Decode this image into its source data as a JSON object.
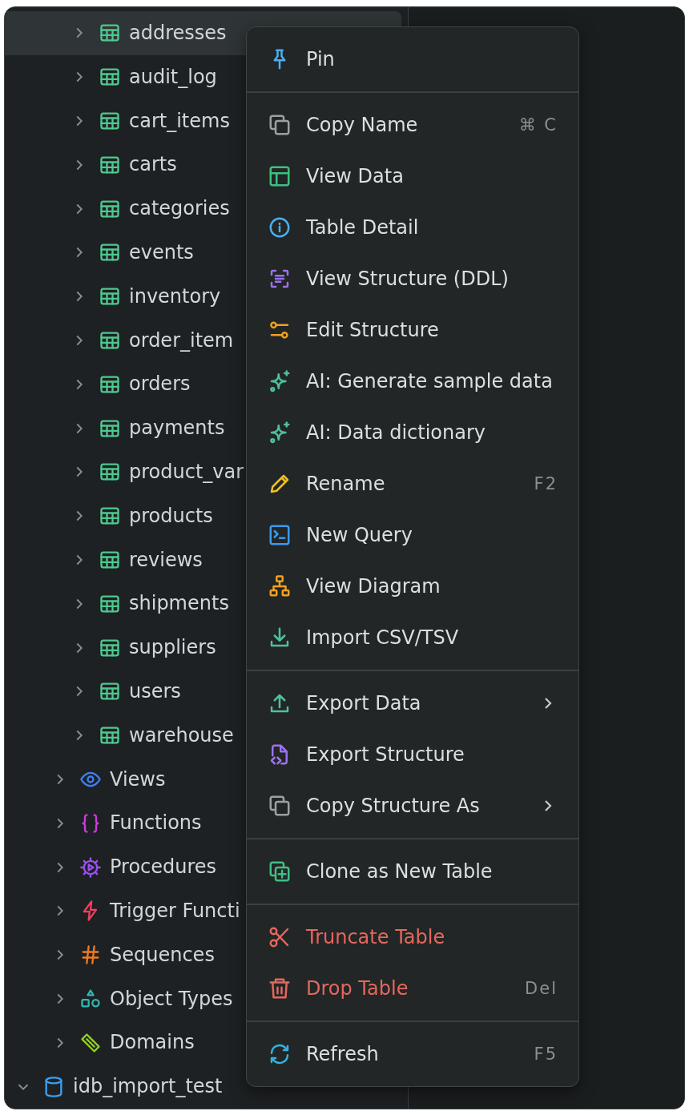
{
  "tree": {
    "tables": [
      {
        "label": "addresses",
        "selected": true,
        "expanded": false
      },
      {
        "label": "audit_log",
        "selected": false,
        "expanded": false
      },
      {
        "label": "cart_items",
        "selected": false,
        "expanded": false
      },
      {
        "label": "carts",
        "selected": false,
        "expanded": false
      },
      {
        "label": "categories",
        "selected": false,
        "expanded": false
      },
      {
        "label": "events",
        "selected": false,
        "expanded": false
      },
      {
        "label": "inventory",
        "selected": false,
        "expanded": false
      },
      {
        "label": "order_item",
        "selected": false,
        "expanded": false
      },
      {
        "label": "orders",
        "selected": false,
        "expanded": false
      },
      {
        "label": "payments",
        "selected": false,
        "expanded": false
      },
      {
        "label": "product_var",
        "selected": false,
        "expanded": false
      },
      {
        "label": "products",
        "selected": false,
        "expanded": false
      },
      {
        "label": "reviews",
        "selected": false,
        "expanded": false
      },
      {
        "label": "shipments",
        "selected": false,
        "expanded": false
      },
      {
        "label": "suppliers",
        "selected": false,
        "expanded": false
      },
      {
        "label": "users",
        "selected": false,
        "expanded": false
      },
      {
        "label": "warehouse",
        "selected": false,
        "expanded": false
      }
    ],
    "schema_objects": [
      {
        "label": "Views",
        "selected": false,
        "expanded": false
      },
      {
        "label": "Functions",
        "selected": false,
        "expanded": false
      },
      {
        "label": "Procedures",
        "selected": false,
        "expanded": false
      },
      {
        "label": "Trigger Functi",
        "selected": false,
        "expanded": false
      },
      {
        "label": "Sequences",
        "selected": false,
        "expanded": false
      },
      {
        "label": "Object Types",
        "selected": false,
        "expanded": false
      },
      {
        "label": "Domains",
        "selected": false,
        "expanded": false
      }
    ],
    "databases": [
      {
        "label": "idb_import_test",
        "selected": false,
        "expanded": true
      }
    ]
  },
  "context_menu": {
    "sections": [
      {
        "items": [
          {
            "label": "Pin",
            "danger": false,
            "submenu": false
          }
        ]
      },
      {
        "items": [
          {
            "label": "Copy Name",
            "shortcut": "⌘ C",
            "danger": false,
            "submenu": false
          },
          {
            "label": "View Data",
            "danger": false,
            "submenu": false
          },
          {
            "label": "Table Detail",
            "danger": false,
            "submenu": false
          },
          {
            "label": "View Structure (DDL)",
            "danger": false,
            "submenu": false
          },
          {
            "label": "Edit Structure",
            "danger": false,
            "submenu": false
          },
          {
            "label": "AI: Generate sample data",
            "danger": false,
            "submenu": false
          },
          {
            "label": "AI: Data dictionary",
            "danger": false,
            "submenu": false
          },
          {
            "label": "Rename",
            "shortcut": "F2",
            "danger": false,
            "submenu": false
          },
          {
            "label": "New Query",
            "danger": false,
            "submenu": false
          },
          {
            "label": "View Diagram",
            "danger": false,
            "submenu": false
          },
          {
            "label": "Import CSV/TSV",
            "danger": false,
            "submenu": false
          }
        ]
      },
      {
        "items": [
          {
            "label": "Export Data",
            "danger": false,
            "submenu": true
          },
          {
            "label": "Export Structure",
            "danger": false,
            "submenu": false
          },
          {
            "label": "Copy Structure As",
            "danger": false,
            "submenu": true
          }
        ]
      },
      {
        "items": [
          {
            "label": "Clone as New Table",
            "danger": false,
            "submenu": false
          }
        ]
      },
      {
        "items": [
          {
            "label": "Truncate Table",
            "danger": true,
            "submenu": false
          },
          {
            "label": "Drop Table",
            "shortcut": "Del",
            "danger": true,
            "submenu": false
          }
        ]
      },
      {
        "items": [
          {
            "label": "Refresh",
            "shortcut": "F5",
            "danger": false,
            "submenu": false
          }
        ]
      }
    ]
  }
}
